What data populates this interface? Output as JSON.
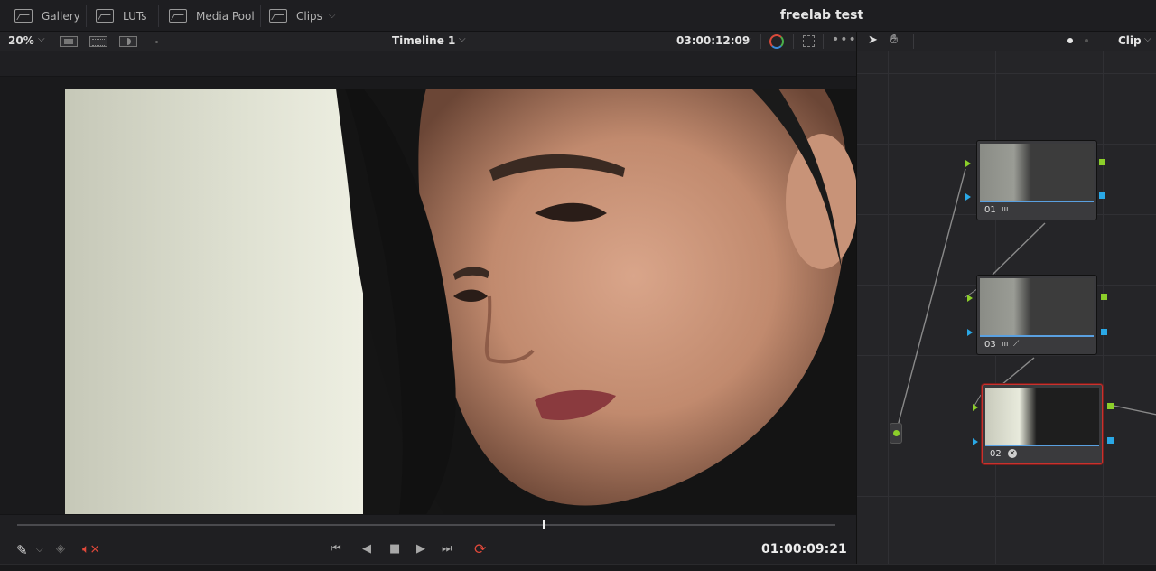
{
  "topbar": {
    "gallery": "Gallery",
    "luts": "LUTs",
    "media_pool": "Media Pool",
    "clips": "Clips",
    "project_title": "freelab test"
  },
  "viewer": {
    "zoom": "20%",
    "timeline_name": "Timeline 1",
    "source_timecode": "03:00:12:09"
  },
  "transport": {
    "timecode": "01:00:09:21",
    "playhead_fraction": 0.643
  },
  "nodes": {
    "mode": "Clip",
    "items": [
      {
        "label": "01"
      },
      {
        "label": "03"
      },
      {
        "label": "02"
      }
    ]
  },
  "colors": {
    "accent_red": "#c8322e",
    "node_output_green": "#8ccf2a",
    "node_key_blue": "#2aa8e6",
    "loop_active": "#e0483a"
  }
}
